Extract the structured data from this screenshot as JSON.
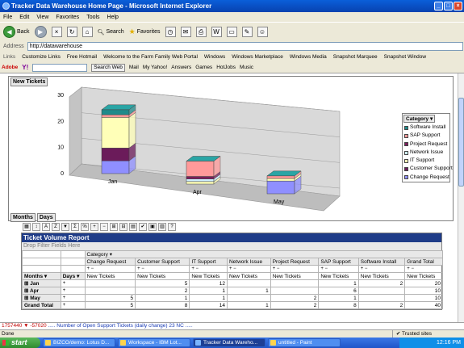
{
  "window": {
    "title": "Tracker Data Warehouse Home Page - Microsoft Internet Explorer"
  },
  "menu": [
    "File",
    "Edit",
    "View",
    "Favorites",
    "Tools",
    "Help"
  ],
  "toolbar": {
    "back": "Back",
    "search": "Search",
    "favorites": "Favorites"
  },
  "address": {
    "label": "Address",
    "url": "http://datawarehouse"
  },
  "links": {
    "label": "Links",
    "items": [
      "Customize Links",
      "Free Hotmail",
      "Welcome to the Farm Family Web Portal",
      "Windows",
      "Windows Marketplace",
      "Windows Media",
      "Snapshot Marquee",
      "Snapshot Window"
    ]
  },
  "search_toolbar": {
    "adobe": "Adobe",
    "yahoo": "Y!",
    "search_button": "Search Web",
    "items": [
      "Mail",
      "My Yahoo!",
      "Answers",
      "Games",
      "HotJobs",
      "Music"
    ]
  },
  "chart": {
    "title_chip": "New Tickets",
    "axis_chips": [
      "Months",
      "Days"
    ],
    "legend_title": "Category",
    "colors": {
      "Software Install": "#1f8a8a",
      "SAP Support": "#ff9a9a",
      "Project Request": "#7b1f5c",
      "Network Issue": "#cfefff",
      "IT Support": "#ffffb8",
      "Customer Support": "#6b1b5a",
      "Change Request": "#8f8fff"
    }
  },
  "chart_data": {
    "type": "bar",
    "stacked": true,
    "three_d": true,
    "categories": [
      "Jan",
      "Apr",
      "May"
    ],
    "ylim": [
      0,
      30
    ],
    "yticks": [
      0,
      10,
      20,
      30
    ],
    "series": [
      {
        "name": "Change Request",
        "values": [
          5,
          0,
          5
        ]
      },
      {
        "name": "Customer Support",
        "values": [
          5,
          0,
          0
        ]
      },
      {
        "name": "IT Support",
        "values": [
          12,
          1,
          1
        ]
      },
      {
        "name": "Network Issue",
        "values": [
          0,
          1,
          0
        ]
      },
      {
        "name": "Project Request",
        "values": [
          0,
          1,
          0
        ]
      },
      {
        "name": "SAP Support",
        "values": [
          1,
          6,
          1
        ]
      },
      {
        "name": "Software Install",
        "values": [
          2,
          0,
          0
        ]
      }
    ],
    "legend": "right"
  },
  "pivot": {
    "title": "Ticket Volume Report",
    "drop_filter": "Drop Filter Fields Here",
    "category_label": "Category",
    "columns": [
      "Change Request",
      "Customer Support",
      "IT Support",
      "Network Issue",
      "Project Request",
      "SAP Support",
      "Software Install",
      "Grand Total"
    ],
    "measure": "New Tickets",
    "row_headers": [
      "Months",
      "Days"
    ],
    "rows": [
      {
        "label": "Jan",
        "values": [
          "",
          "5",
          "12",
          "",
          "",
          "1",
          "2",
          "20"
        ]
      },
      {
        "label": "Apr",
        "values": [
          "",
          "2",
          "1",
          "1",
          "",
          "6",
          "",
          "10"
        ]
      },
      {
        "label": "May",
        "values": [
          "5",
          "1",
          "1",
          "",
          "2",
          "1",
          "",
          "10"
        ]
      },
      {
        "label": "Grand Total",
        "values": [
          "5",
          "8",
          "14",
          "1",
          "2",
          "8",
          "2",
          "40"
        ]
      }
    ]
  },
  "ticker": {
    "prefix": "1757440",
    "change": "-57020",
    "text": "..... Number of Open Support Tickets (daily change) 23 NC ....."
  },
  "status": {
    "left": "Done",
    "zone": "Trusted sites"
  },
  "taskbar": {
    "start": "start",
    "tasks": [
      "BIZCO/demo: Lotus D...",
      "Workspace - IBM Lot...",
      "Tracker Data Wareho...",
      "untitled - Paint"
    ],
    "time": "12:16 PM"
  }
}
